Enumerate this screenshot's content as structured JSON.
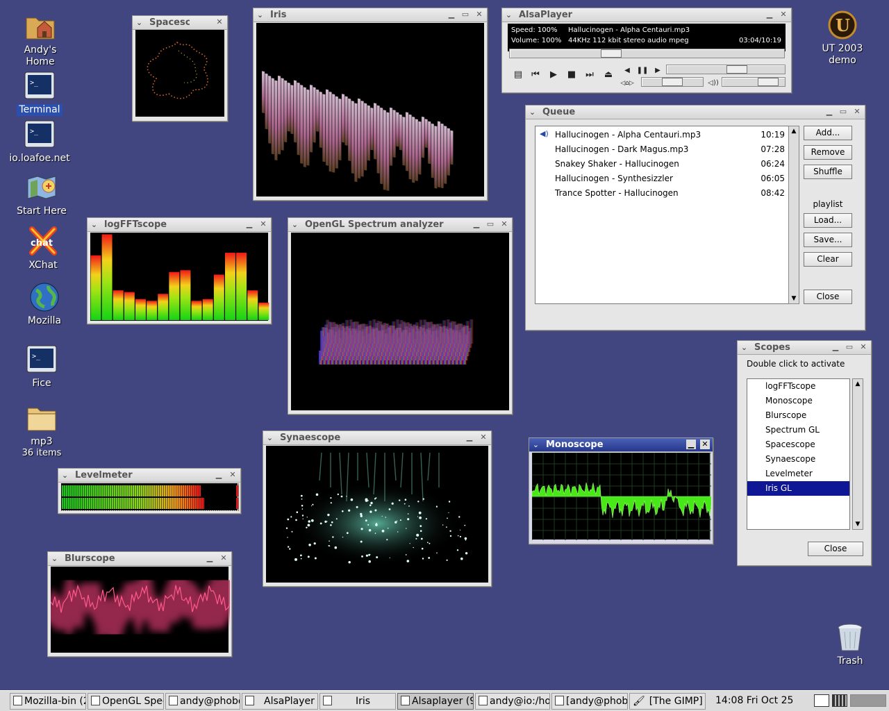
{
  "desktop": {
    "icons": [
      {
        "label": "Andy's Home",
        "icon": "home-folder-icon"
      },
      {
        "label": "Terminal",
        "icon": "terminal-icon"
      },
      {
        "label": "io.loafoe.net",
        "icon": "terminal-icon"
      },
      {
        "label": "Start Here",
        "icon": "start-here-icon"
      },
      {
        "label": "XChat",
        "icon": "xchat-icon"
      },
      {
        "label": "Mozilla",
        "icon": "globe-icon"
      },
      {
        "label": "Fice",
        "icon": "terminal-icon"
      },
      {
        "label": "mp3",
        "sub": "36 items",
        "icon": "folder-icon"
      },
      {
        "label": "UT 2003 demo",
        "icon": "unreal-icon"
      },
      {
        "label": "Trash",
        "icon": "trash-icon"
      }
    ]
  },
  "windows": {
    "spacescope": {
      "title": "Spacescope"
    },
    "iris": {
      "title": "Iris"
    },
    "logfft": {
      "title": "logFFTscope"
    },
    "opengl": {
      "title": "OpenGL Spectrum analyzer"
    },
    "levelmeter": {
      "title": "Levelmeter"
    },
    "blurscope": {
      "title": "Blurscope"
    },
    "synaescope": {
      "title": "Synaescope"
    },
    "monoscope": {
      "title": "Monoscope"
    },
    "alsaplayer": {
      "title": "AlsaPlayer",
      "speed": "Speed: 100%",
      "volume": "Volume: 100%",
      "track": "Hallucinogen - Alpha Centauri.mp3",
      "info": "44KHz 112 kbit stereo audio mpeg",
      "time": "03:04/10:19",
      "seek_position": 0.36,
      "volume_level": 0.85,
      "balance_position": 0.5
    },
    "queue": {
      "title": "Queue",
      "items": [
        {
          "name": "Hallucinogen - Alpha Centauri.mp3",
          "time": "10:19"
        },
        {
          "name": "Hallucinogen - Dark Magus.mp3",
          "time": "07:28"
        },
        {
          "name": "Snakey Shaker - Hallucinogen",
          "time": "06:24"
        },
        {
          "name": "Hallucinogen - Synthesizzler",
          "time": "06:05"
        },
        {
          "name": "Trance Spotter - Hallucinogen",
          "time": "08:42"
        }
      ],
      "buttons": {
        "add": "Add...",
        "remove": "Remove",
        "shuffle": "Shuffle",
        "playlist": "playlist",
        "load": "Load...",
        "save": "Save...",
        "clear": "Clear",
        "close": "Close"
      }
    },
    "scopes": {
      "title": "Scopes",
      "hint": "Double click to activate",
      "items": [
        "logFFTscope",
        "Monoscope",
        "Blurscope",
        "Spectrum GL",
        "Spacescope",
        "Synaescope",
        "Levelmeter",
        "Iris GL"
      ],
      "selected": "Iris GL",
      "close": "Close"
    }
  },
  "logfft_bars": [
    0.74,
    0.98,
    0.34,
    0.32,
    0.24,
    0.22,
    0.3,
    0.55,
    0.57,
    0.22,
    0.24,
    0.52,
    0.77,
    0.77,
    0.34,
    0.2
  ],
  "levelmeter": {
    "left": 0.8,
    "right": 0.82
  },
  "taskbar": {
    "tasks": [
      "Mozilla-bin (2",
      "OpenGL Spec",
      "andy@phobo",
      "AlsaPlayer",
      "Iris",
      "Alsaplayer (9",
      "andy@io:/ho",
      "[andy@phob",
      "[The GIMP]"
    ],
    "clock": "14:08 Fri Oct 25"
  },
  "colors": {
    "desktop": "#414680",
    "selection": "#0f1794",
    "active_title": "#26378a"
  }
}
